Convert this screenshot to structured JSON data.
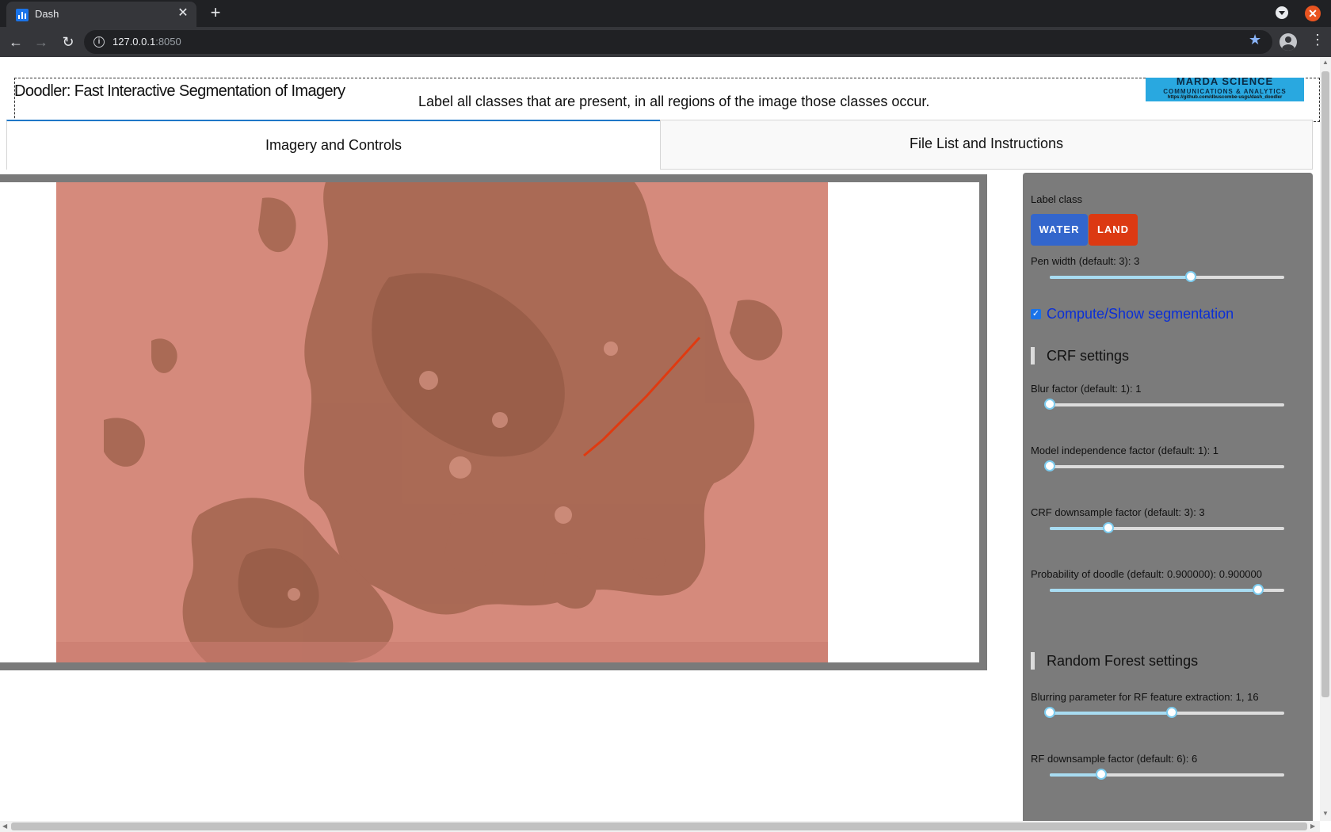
{
  "browser": {
    "tab_title": "Dash",
    "url_host": "127.0.0.1",
    "url_port": ":8050"
  },
  "header": {
    "title": "Doodler: Fast Interactive Segmentation of Imagery",
    "instruction": "Label all classes that are present, in all regions of the image those classes occur.",
    "logo_line1": "MARDA SCIENCE",
    "logo_line2": "COMMUNICATIONS & ANALYTICS",
    "logo_url": "https://github.com/dbuscombe-usgs/dash_doodler"
  },
  "tabs": [
    {
      "label": "Imagery and Controls",
      "active": true
    },
    {
      "label": "File List and Instructions",
      "active": false
    }
  ],
  "controls": {
    "label_class_title": "Label class",
    "classes": [
      {
        "label": "WATER",
        "color": "#3366cc"
      },
      {
        "label": "LAND",
        "color": "#dc3912"
      }
    ],
    "pen_width": {
      "label": "Pen width (default: 3): 3",
      "value_fraction": 0.6
    },
    "compute_segmentation": {
      "label": "Compute/Show segmentation",
      "checked": true
    },
    "crf_section": "CRF settings",
    "crf_sliders": [
      {
        "label": "Blur factor (default: 1): 1",
        "value_fraction": 0.0
      },
      {
        "label": "Model independence factor (default: 1): 1",
        "value_fraction": 0.0
      },
      {
        "label": "CRF downsample factor (default: 3): 3",
        "value_fraction": 0.25
      },
      {
        "label": "Probability of doodle (default: 0.900000): 0.900000",
        "value_fraction": 0.89
      }
    ],
    "rf_section": "Random Forest settings",
    "rf_sliders": [
      {
        "label": "Blurring parameter for RF feature extraction: 1, 16",
        "range_fraction": [
          0.0,
          0.52
        ]
      },
      {
        "label": "RF downsample factor (default: 6): 6",
        "value_fraction": 0.22
      }
    ]
  },
  "colors": {
    "accent_tab": "#1f78c8",
    "panel": "#7b7b7b",
    "water": "#3366cc",
    "land": "#dc3912",
    "slider_track_fill": "#a8dcf2"
  }
}
